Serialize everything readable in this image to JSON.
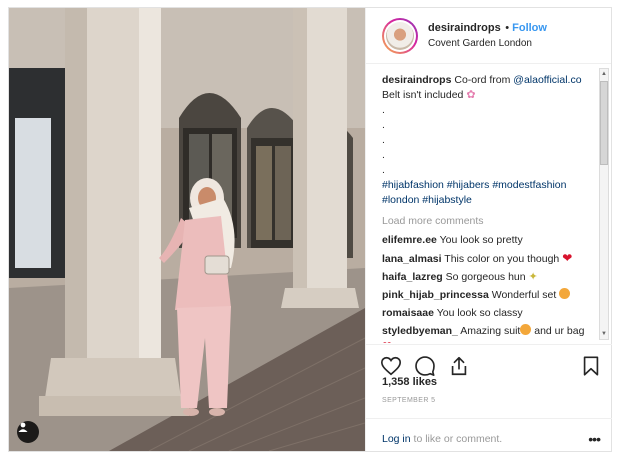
{
  "post": {
    "username": "desiraindrops",
    "follow_label": "Follow",
    "location": "Covent Garden London",
    "caption": {
      "username": "desiraindrops",
      "text_before_mention": "Co-ord from ",
      "mention": "@alaofficial.co",
      "line2": "Belt isn't included",
      "dots": [
        ".",
        ".",
        ".",
        ".",
        "."
      ],
      "hashtags_line1": "#hijabfashion #hijabers #modestfashion",
      "hashtags_line2": "#london #hijabstyle"
    },
    "load_more_label": "Load more comments",
    "comments": [
      {
        "user": "elifemre.ee",
        "text": "You look so pretty"
      },
      {
        "user": "lana_almasi",
        "text": "This color on you though"
      },
      {
        "user": "haifa_lazreg",
        "text": "So gorgeous hun"
      },
      {
        "user": "pink_hijab_princessa",
        "text": "Wonderful set"
      },
      {
        "user": "romaisaae",
        "text": "You look so classy"
      },
      {
        "user": "styledbyeman_",
        "text": "Amazing suit",
        "text_after": " and ur bag"
      }
    ],
    "likes": "1,358 likes",
    "date": "SEPTEMBER 5",
    "login_link": "Log in",
    "login_suffix": " to like or comment.",
    "more_label": "•••"
  },
  "icons": [
    "heart-icon",
    "comment-icon",
    "share-icon",
    "bookmark-icon",
    "user-tag-icon",
    "more-options-icon"
  ],
  "colors": {
    "follow_blue": "#3897f0",
    "link_navy": "#003569",
    "muted_gray": "#999999",
    "heart_red": "#d8132d"
  }
}
